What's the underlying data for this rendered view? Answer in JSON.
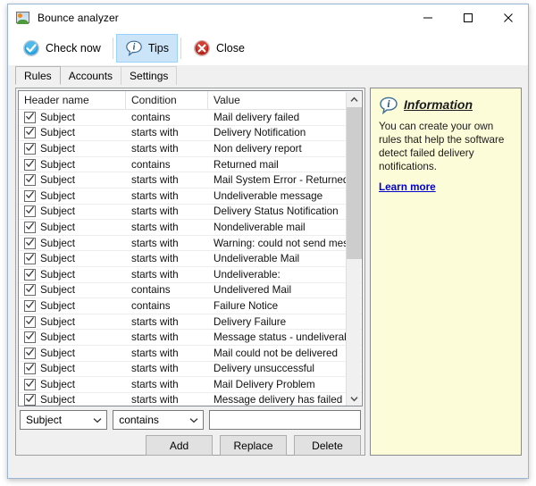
{
  "window": {
    "title": "Bounce analyzer",
    "icon": "picture-icon",
    "controls": {
      "minimize": "minimize-icon",
      "maximize": "maximize-icon",
      "close": "close-icon"
    }
  },
  "toolbar": {
    "buttons": [
      {
        "label": "Check now",
        "icon": "check-circle-icon",
        "highlighted": false
      },
      {
        "label": "Tips",
        "icon": "info-balloon-icon",
        "highlighted": true
      },
      {
        "label": "Close",
        "icon": "close-circle-icon",
        "highlighted": false
      }
    ]
  },
  "tabs": [
    {
      "label": "Rules",
      "active": true
    },
    {
      "label": "Accounts",
      "active": false
    },
    {
      "label": "Settings",
      "active": false
    }
  ],
  "list": {
    "columns": [
      "Header name",
      "Condition",
      "Value"
    ],
    "rows": [
      {
        "checked": true,
        "header": "Subject",
        "condition": "contains",
        "value": "Mail delivery failed"
      },
      {
        "checked": true,
        "header": "Subject",
        "condition": "starts with",
        "value": "Delivery Notification"
      },
      {
        "checked": true,
        "header": "Subject",
        "condition": "starts with",
        "value": "Non delivery report"
      },
      {
        "checked": true,
        "header": "Subject",
        "condition": "contains",
        "value": "Returned mail"
      },
      {
        "checked": true,
        "header": "Subject",
        "condition": "starts with",
        "value": "Mail System Error - Returned M..."
      },
      {
        "checked": true,
        "header": "Subject",
        "condition": "starts with",
        "value": "Undeliverable message"
      },
      {
        "checked": true,
        "header": "Subject",
        "condition": "starts with",
        "value": "Delivery Status Notification"
      },
      {
        "checked": true,
        "header": "Subject",
        "condition": "starts with",
        "value": "Nondeliverable mail"
      },
      {
        "checked": true,
        "header": "Subject",
        "condition": "starts with",
        "value": "Warning: could not send messa..."
      },
      {
        "checked": true,
        "header": "Subject",
        "condition": "starts with",
        "value": "Undeliverable Mail"
      },
      {
        "checked": true,
        "header": "Subject",
        "condition": "starts with",
        "value": "Undeliverable:"
      },
      {
        "checked": true,
        "header": "Subject",
        "condition": "contains",
        "value": "Undelivered Mail"
      },
      {
        "checked": true,
        "header": "Subject",
        "condition": "contains",
        "value": "Failure Notice"
      },
      {
        "checked": true,
        "header": "Subject",
        "condition": "starts with",
        "value": "Delivery Failure"
      },
      {
        "checked": true,
        "header": "Subject",
        "condition": "starts with",
        "value": "Message status - undeliverable"
      },
      {
        "checked": true,
        "header": "Subject",
        "condition": "starts with",
        "value": "Mail could not be delivered"
      },
      {
        "checked": true,
        "header": "Subject",
        "condition": "starts with",
        "value": "Delivery unsuccessful"
      },
      {
        "checked": true,
        "header": "Subject",
        "condition": "starts with",
        "value": "Mail Delivery Problem"
      },
      {
        "checked": true,
        "header": "Subject",
        "condition": "starts with",
        "value": "Message delivery has failed"
      }
    ],
    "scrollbar": {
      "up": "scroll-up-icon",
      "down": "scroll-down-icon"
    }
  },
  "editor": {
    "header_select": {
      "value": "Subject"
    },
    "condition_select": {
      "value": "contains"
    },
    "value_input": {
      "value": "",
      "placeholder": ""
    },
    "buttons": [
      {
        "label": "Add"
      },
      {
        "label": "Replace"
      },
      {
        "label": "Delete"
      }
    ]
  },
  "info": {
    "icon": "info-balloon-icon",
    "title": "Information",
    "text": "You can create your own rules that help the software detect failed delivery notifications.",
    "link": "Learn more"
  },
  "colors": {
    "window_border": "#9ab6d4",
    "info_background": "#fcfcd8",
    "tips_highlight": "#cce4f7",
    "link": "#0000cd",
    "check_green": "#1f9ad6",
    "close_red": "#c0281e"
  }
}
